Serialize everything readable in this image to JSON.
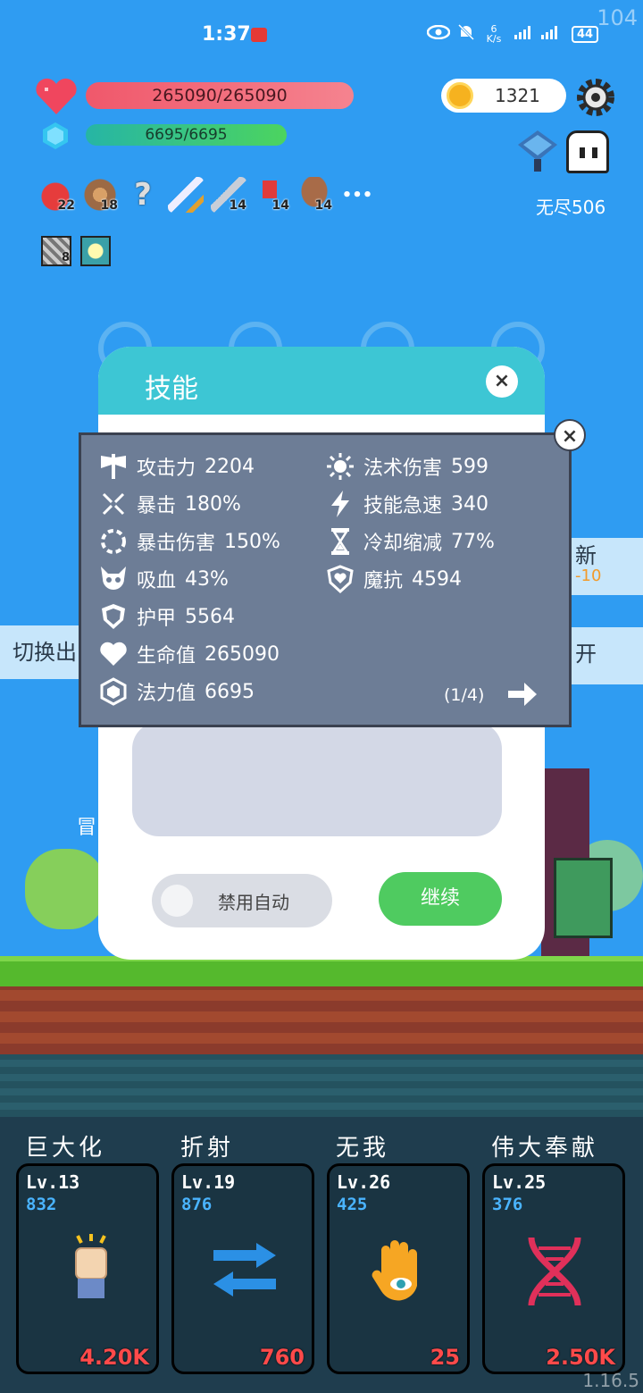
{
  "status": {
    "time": "1:37",
    "net_speed": "6 K/s",
    "signal": "4G 4G",
    "battery": "44"
  },
  "overlay": {
    "fps": "104",
    "version": "1.16.5"
  },
  "hud": {
    "hp": "265090/265090",
    "mp": "6695/6695",
    "coins": "1321",
    "endless": "无尽506"
  },
  "inventory": [
    {
      "name": "apple",
      "count": "22"
    },
    {
      "name": "shield",
      "count": "18"
    },
    {
      "name": "hook",
      "count": ""
    },
    {
      "name": "sword",
      "count": ""
    },
    {
      "name": "greatsword",
      "count": "14"
    },
    {
      "name": "boot",
      "count": "14"
    },
    {
      "name": "door",
      "count": "14"
    }
  ],
  "inventory_more": "•••",
  "inventory_row2": [
    {
      "name": "card",
      "count": "8"
    },
    {
      "name": "bulb",
      "count": ""
    }
  ],
  "side_tabs": {
    "left": "切换出",
    "right_top": "新",
    "right_top_sub": "-10",
    "right_bottom": "开",
    "left_sub": "冒"
  },
  "dialog": {
    "title": "技能",
    "toggle_label": "禁用自动",
    "continue": "继续",
    "close": "×"
  },
  "stats": {
    "left": [
      {
        "icon": "axe-icon",
        "label": "攻击力",
        "value": "2204"
      },
      {
        "icon": "crit-icon",
        "label": "暴击",
        "value": "180%"
      },
      {
        "icon": "crit-damage-icon",
        "label": "暴击伤害",
        "value": "150%"
      },
      {
        "icon": "lifesteal-icon",
        "label": "吸血",
        "value": "43%"
      },
      {
        "icon": "armor-icon",
        "label": "护甲",
        "value": "5564"
      },
      {
        "icon": "heart-icon",
        "label": "生命值",
        "value": "265090"
      },
      {
        "icon": "mana-icon",
        "label": "法力值",
        "value": "6695"
      }
    ],
    "right": [
      {
        "icon": "sun-icon",
        "label": "法术伤害",
        "value": "599"
      },
      {
        "icon": "bolt-icon",
        "label": "技能急速",
        "value": "340"
      },
      {
        "icon": "hourglass-icon",
        "label": "冷却缩减",
        "value": "77%"
      },
      {
        "icon": "magic-shield-icon",
        "label": "魔抗",
        "value": "4594"
      }
    ],
    "page": "(1/4)",
    "close": "×"
  },
  "skills": [
    {
      "name": "巨大化",
      "level": "Lv.13",
      "value": "832",
      "cost": "4.20K",
      "icon": "fist-icon"
    },
    {
      "name": "折射",
      "level": "Lv.19",
      "value": "876",
      "cost": "760",
      "icon": "swap-arrows-icon"
    },
    {
      "name": "无我",
      "level": "Lv.26",
      "value": "425",
      "cost": "25",
      "icon": "eye-hand-icon"
    },
    {
      "name": "伟大奉献",
      "level": "Lv.25",
      "value": "376",
      "cost": "2.50K",
      "icon": "dna-icon"
    }
  ],
  "colors": {
    "bg": "#2f9cf2",
    "accent": "#3dc6d4",
    "continue": "#4fcb60",
    "cost": "#ff4a4a",
    "card_value": "#4ab4ff"
  }
}
